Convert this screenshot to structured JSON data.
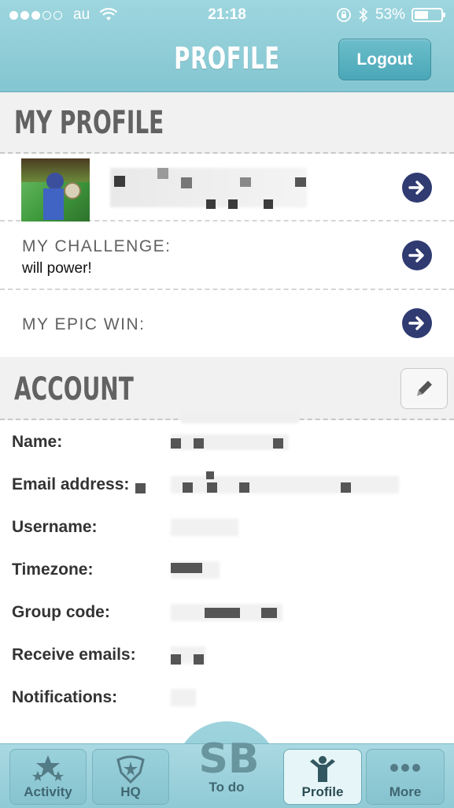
{
  "status_bar": {
    "carrier": "au",
    "time": "21:18",
    "battery_percent": "53%",
    "battery_level": 0.53
  },
  "nav": {
    "title": "PROFILE",
    "logout_label": "Logout"
  },
  "my_profile": {
    "title": "MY PROFILE",
    "challenge_label": "MY CHALLENGE:",
    "challenge_value": "will power!",
    "epic_win_label": "MY EPIC WIN:"
  },
  "account": {
    "title": "ACCOUNT",
    "fields": [
      {
        "label": "Name:"
      },
      {
        "label": "Email address:"
      },
      {
        "label": "Username:"
      },
      {
        "label": "Timezone:"
      },
      {
        "label": "Group code:"
      },
      {
        "label": "Receive emails:"
      },
      {
        "label": "Notifications:"
      }
    ]
  },
  "tabbar": {
    "items": [
      {
        "label": "Activity",
        "icon": "stars-icon"
      },
      {
        "label": "HQ",
        "icon": "hq-badge-icon"
      },
      {
        "label": "To do",
        "icon": "sb-logo-icon"
      },
      {
        "label": "Profile",
        "icon": "person-icon",
        "active": true
      },
      {
        "label": "More",
        "icon": "more-dots-icon"
      }
    ]
  },
  "colors": {
    "header": "#8fcbd6",
    "arrow_button": "#2f3b71",
    "section_bg": "#f1f1f1"
  }
}
